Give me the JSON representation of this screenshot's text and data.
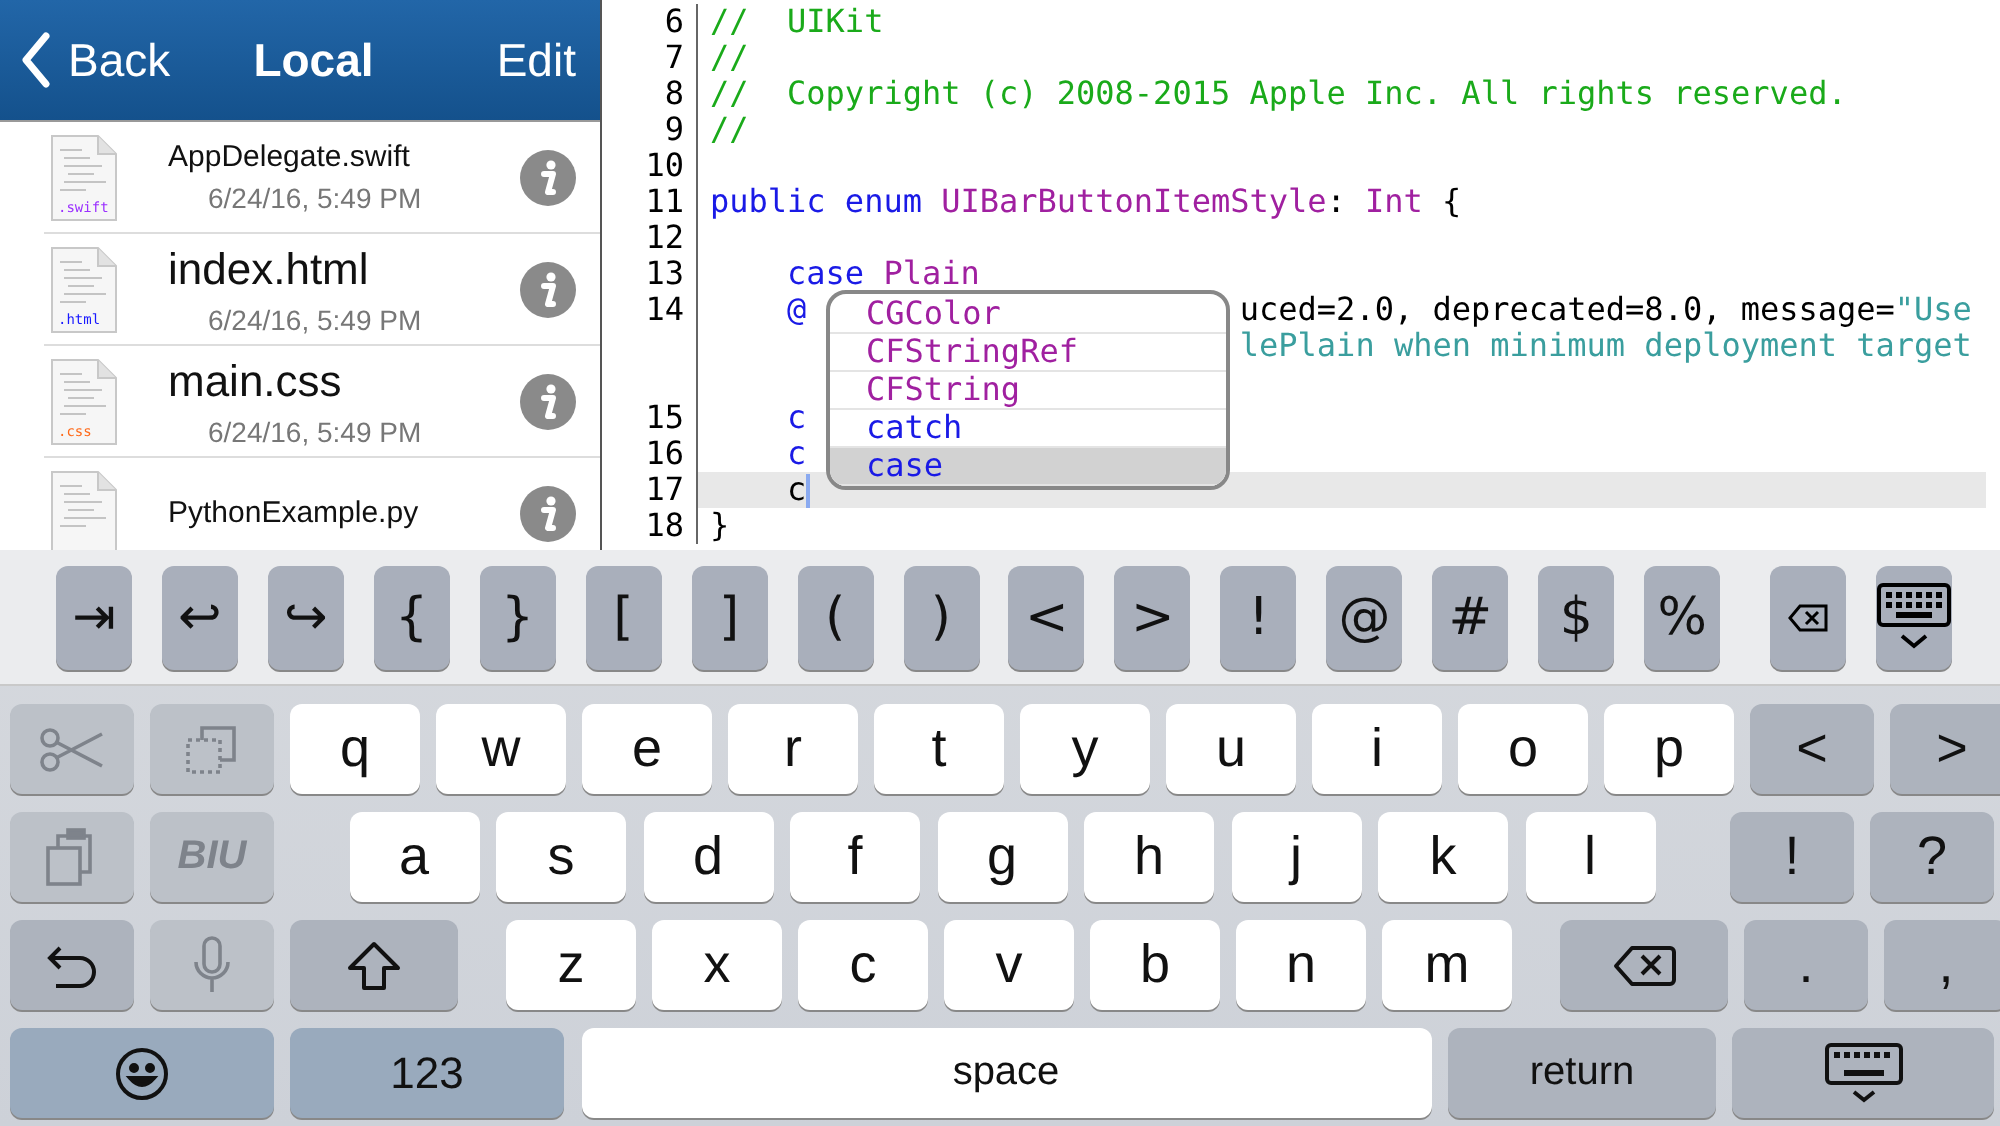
{
  "sidebar": {
    "back": "Back",
    "title": "Local",
    "edit": "Edit",
    "files": [
      {
        "name": "AppDelegate.swift",
        "date": "6/24/16, 5:49 PM",
        "ext": ".swift",
        "color": "#9b30ff"
      },
      {
        "name": "index.html",
        "date": "6/24/16, 5:49 PM",
        "ext": ".html",
        "color": "#1a1aff"
      },
      {
        "name": "main.css",
        "date": "6/24/16, 5:49 PM",
        "ext": ".css",
        "color": "#ff6a1a"
      },
      {
        "name": "PythonExample.py"
      }
    ]
  },
  "editor": {
    "lines": [
      {
        "number": "6",
        "tokens": [
          {
            "kind": "comment",
            "text": "//  UIKit"
          }
        ]
      },
      {
        "number": "7",
        "tokens": [
          {
            "kind": "comment",
            "text": "//"
          }
        ]
      },
      {
        "number": "8",
        "tokens": [
          {
            "kind": "comment",
            "text": "//  Copyright (c) 2008-2015 Apple Inc. All rights reserved."
          }
        ]
      },
      {
        "number": "9",
        "tokens": [
          {
            "kind": "comment",
            "text": "//"
          }
        ]
      },
      {
        "number": "10"
      },
      {
        "number": "11",
        "tokens": [
          {
            "kind": "keyword",
            "text": "public enum "
          },
          {
            "kind": "type",
            "text": "UIBarButtonItemStyle"
          },
          {
            "kind": "plain",
            "text": ": "
          },
          {
            "kind": "type",
            "text": "Int"
          },
          {
            "kind": "plain",
            "text": " {"
          }
        ]
      },
      {
        "number": "12"
      },
      {
        "number": "13",
        "indented": true,
        "tokens": [
          {
            "kind": "keyword",
            "text": "case "
          },
          {
            "kind": "type",
            "text": "Plain"
          }
        ]
      },
      {
        "number": "14",
        "indented": true,
        "tokens": [
          {
            "kind": "keyword",
            "text": "@"
          }
        ],
        "after": [
          {
            "kind": "plain",
            "text": "uced=2.0, deprecated=8.0, message="
          },
          {
            "kind": "string",
            "text": "\"Use"
          }
        ]
      },
      {
        "after": [
          {
            "kind": "string",
            "text": "lePlain when minimum deployment target"
          }
        ]
      },
      {
        "number": "15",
        "indented": true,
        "tokens": [
          {
            "kind": "keyword",
            "text": "c"
          }
        ]
      },
      {
        "number": "16",
        "indented": true,
        "tokens": [
          {
            "kind": "keyword",
            "text": "c"
          }
        ]
      },
      {
        "number": "17",
        "indented": true,
        "current": true,
        "tokens": [
          {
            "kind": "plain",
            "text": "c"
          }
        ]
      },
      {
        "number": "18",
        "tokens": [
          {
            "kind": "plain",
            "text": "}"
          }
        ]
      }
    ],
    "completions": [
      {
        "text": "CGColor",
        "kind": "type",
        "selected": false
      },
      {
        "text": "CFStringRef",
        "kind": "type",
        "selected": false
      },
      {
        "text": "CFString",
        "kind": "type",
        "selected": false
      },
      {
        "text": "catch",
        "kind": "keyword",
        "selected": false
      },
      {
        "text": "case",
        "kind": "keyword",
        "selected": true
      }
    ]
  },
  "keyboard": {
    "accessory": [
      {
        "kind": "text",
        "label": "⇥"
      },
      {
        "kind": "text",
        "label": "↩"
      },
      {
        "kind": "text",
        "label": "↪"
      },
      {
        "kind": "text",
        "label": "{"
      },
      {
        "kind": "text",
        "label": "}"
      },
      {
        "kind": "text",
        "label": "["
      },
      {
        "kind": "text",
        "label": "]"
      },
      {
        "kind": "text",
        "label": "("
      },
      {
        "kind": "text",
        "label": ")"
      },
      {
        "kind": "text",
        "label": "<"
      },
      {
        "kind": "text",
        "label": ">"
      },
      {
        "kind": "text",
        "label": "!"
      },
      {
        "kind": "text",
        "label": "@"
      },
      {
        "kind": "text",
        "label": "#"
      },
      {
        "kind": "text",
        "label": "$"
      },
      {
        "kind": "text",
        "label": "%"
      },
      {
        "kind": "clear"
      },
      {
        "kind": "hide-keyboard"
      }
    ],
    "rows": [
      {
        "left": [
          {
            "kind": "scissors",
            "disabled": true
          },
          {
            "kind": "copy",
            "disabled": true
          }
        ],
        "middle": [
          {
            "kind": "letter",
            "label": "q",
            "disabled": false
          },
          {
            "kind": "letter",
            "label": "w",
            "disabled": false
          },
          {
            "kind": "letter",
            "label": "e",
            "disabled": false
          },
          {
            "kind": "letter",
            "label": "r",
            "disabled": false
          },
          {
            "kind": "letter",
            "label": "t",
            "disabled": false
          },
          {
            "kind": "letter",
            "label": "y",
            "disabled": false
          },
          {
            "kind": "letter",
            "label": "u",
            "disabled": false
          },
          {
            "kind": "letter",
            "label": "i",
            "disabled": false
          },
          {
            "kind": "letter",
            "label": "o",
            "disabled": false
          },
          {
            "kind": "letter",
            "label": "p",
            "disabled": false
          }
        ],
        "right": [
          {
            "kind": "symbol",
            "label": "<",
            "disabled": false
          },
          {
            "kind": "symbol",
            "label": ">",
            "disabled": false
          }
        ]
      },
      {
        "left": [
          {
            "kind": "paste",
            "disabled": true
          },
          {
            "kind": "symbol",
            "label": "BIU",
            "disabled": true
          }
        ],
        "middle": [
          {
            "kind": "letter",
            "label": "a",
            "disabled": false
          },
          {
            "kind": "letter",
            "label": "s",
            "disabled": false
          },
          {
            "kind": "letter",
            "label": "d",
            "disabled": false
          },
          {
            "kind": "letter",
            "label": "f",
            "disabled": false
          },
          {
            "kind": "letter",
            "label": "g",
            "disabled": false
          },
          {
            "kind": "letter",
            "label": "h",
            "disabled": false
          },
          {
            "kind": "letter",
            "label": "j",
            "disabled": false
          },
          {
            "kind": "letter",
            "label": "k",
            "disabled": false
          },
          {
            "kind": "letter",
            "label": "l",
            "disabled": false
          }
        ],
        "right": [
          {
            "kind": "symbol",
            "label": "!",
            "disabled": false
          },
          {
            "kind": "symbol",
            "label": "?",
            "disabled": false
          }
        ]
      },
      {
        "left": [
          {
            "kind": "undo",
            "disabled": false
          },
          {
            "kind": "mic",
            "disabled": true
          }
        ],
        "middle": [
          {
            "kind": "shift",
            "disabled": false
          },
          {
            "kind": "letter",
            "label": "z",
            "disabled": false
          },
          {
            "kind": "letter",
            "label": "x",
            "disabled": false
          },
          {
            "kind": "letter",
            "label": "c",
            "disabled": false
          },
          {
            "kind": "letter",
            "label": "v",
            "disabled": false
          },
          {
            "kind": "letter",
            "label": "b",
            "disabled": false
          },
          {
            "kind": "letter",
            "label": "n",
            "disabled": false
          },
          {
            "kind": "letter",
            "label": "m",
            "disabled": false
          },
          {
            "kind": "backspace",
            "disabled": false
          }
        ],
        "right": [
          {
            "kind": "symbol",
            "label": ".",
            "disabled": false
          },
          {
            "kind": "symbol",
            "label": ",",
            "disabled": false
          }
        ]
      },
      {
        "left": [
          {
            "kind": "emoji",
            "disabled": false
          },
          {
            "kind": "mode",
            "label": "123",
            "disabled": false
          }
        ],
        "middle": [
          {
            "kind": "space",
            "label": "space",
            "disabled": false
          }
        ],
        "right": [
          {
            "kind": "return",
            "label": "return",
            "disabled": false
          },
          {
            "kind": "hide-keyboard",
            "disabled": false
          }
        ]
      }
    ]
  }
}
